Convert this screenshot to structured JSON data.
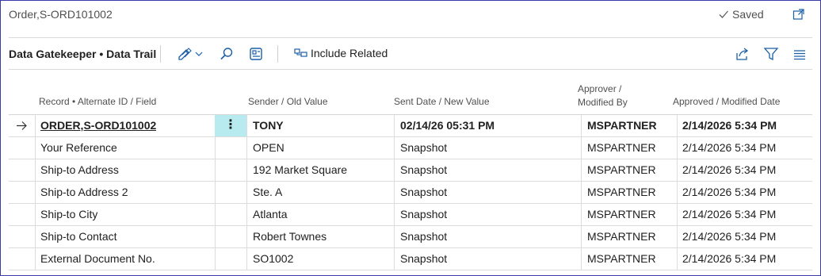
{
  "window": {
    "title": "Order,S-ORD101002",
    "saved_label": "Saved"
  },
  "toolbar": {
    "page_name": "Data Gatekeeper • Data Trail",
    "include_related_label": "Include Related"
  },
  "grid": {
    "headers": {
      "record": "Record • Alternate ID / Field",
      "sender": "Sender / Old Value",
      "sent_date": "Sent Date / New Value",
      "approver_line1": "Approver /",
      "approver_line2": "Modified By",
      "approved_date": "Approved / Modified Date"
    },
    "rows": [
      {
        "field": "ORDER,S-ORD101002",
        "old": "TONY",
        "new": "02/14/26 05:31 PM",
        "by": "MSPARTNER",
        "date": "2/14/2026 5:34 PM"
      },
      {
        "field": "Your Reference",
        "old": "OPEN",
        "new": "Snapshot",
        "by": "MSPARTNER",
        "date": "2/14/2026 5:34 PM"
      },
      {
        "field": "Ship-to Address",
        "old": "192 Market Square",
        "new": "Snapshot",
        "by": "MSPARTNER",
        "date": "2/14/2026 5:34 PM"
      },
      {
        "field": "Ship-to Address 2",
        "old": "Ste. A",
        "new": "Snapshot",
        "by": "MSPARTNER",
        "date": "2/14/2026 5:34 PM"
      },
      {
        "field": "Ship-to City",
        "old": "Atlanta",
        "new": "Snapshot",
        "by": "MSPARTNER",
        "date": "2/14/2026 5:34 PM"
      },
      {
        "field": "Ship-to Contact",
        "old": "Robert Townes",
        "new": "Snapshot",
        "by": "MSPARTNER",
        "date": "2/14/2026 5:34 PM"
      },
      {
        "field": "External Document No.",
        "old": "SO1002",
        "new": "Snapshot",
        "by": "MSPARTNER",
        "date": "2/14/2026 5:34 PM"
      }
    ]
  },
  "colors": {
    "frame_border": "#3a3aa8",
    "icon_accent": "#1a5fa8",
    "selected_cell": "#b8ebef"
  },
  "icons": [
    "checkmark-icon",
    "popout-icon",
    "edit-pencil-icon",
    "search-icon",
    "page-icon",
    "related-icon",
    "share-icon",
    "filter-icon",
    "list-icon",
    "row-arrow-icon",
    "kebab-icon"
  ]
}
